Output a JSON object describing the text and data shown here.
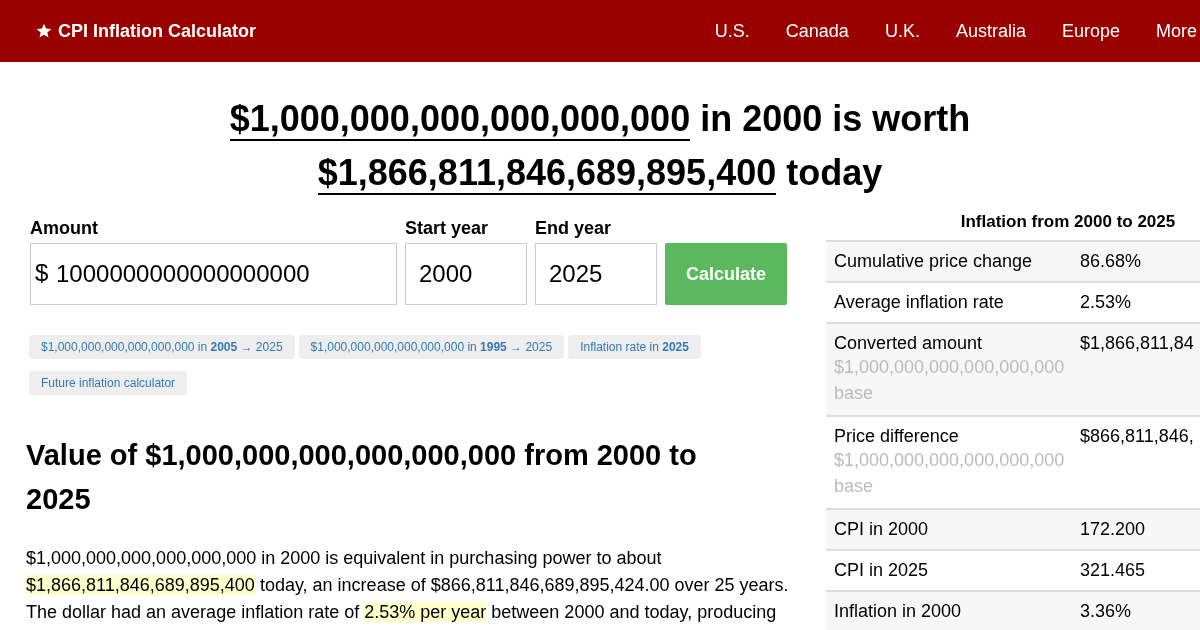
{
  "header": {
    "logo": "CPI Inflation Calculator",
    "nav": [
      "U.S.",
      "Canada",
      "U.K.",
      "Australia",
      "Europe",
      "More"
    ]
  },
  "headline": {
    "lines": [
      [
        {
          "text": "$1,000,000,000,000,000,000",
          "link": true
        },
        {
          "text": " in 2000 is worth",
          "link": false
        }
      ],
      [
        {
          "text": "$1,866,811,846,689,895,400",
          "link": true
        },
        {
          "text": " today",
          "link": false
        }
      ]
    ]
  },
  "form": {
    "fields": [
      {
        "label": "Amount",
        "prefix": "$",
        "value": "1000000000000000000"
      },
      {
        "label": "Start year",
        "value": "2000"
      },
      {
        "label": "End year",
        "value": "2025"
      }
    ],
    "button": "Calculate"
  },
  "chips": [
    "$1,000,000,000,000,000,000 in **2005** → 2025",
    "$1,000,000,000,000,000,000 in **1995** → 2025",
    "Inflation rate in **2025**",
    "Future inflation calculator"
  ],
  "section": {
    "heading": "Value of $1,000,000,000,000,000,000 from 2000 to 2025",
    "paragraph": [
      {
        "text": "$1,000,000,000,000,000,000 in 2000 is equivalent in purchasing power to about ",
        "highlighted": false
      },
      {
        "text": "$1,866,811,846,689,895,400",
        "highlighted": true
      },
      {
        "text": " today, an increase of $866,811,846,689,895,424.00 over 25 years. The dollar had an average inflation rate of ",
        "highlighted": false
      },
      {
        "text": "2.53% per year",
        "highlighted": true
      },
      {
        "text": " between 2000 and today, producing",
        "highlighted": false
      }
    ]
  },
  "table": {
    "title": "Inflation from 2000 to 2025",
    "rows": [
      {
        "label": "Cumulative price change",
        "value": "86.68%"
      },
      {
        "label": "Average inflation rate",
        "value": "2.53%"
      },
      {
        "label": "Converted amount",
        "note": "$1,000,000,000,000,000,000 base",
        "value": "$1,866,811,84"
      },
      {
        "label": "Price difference",
        "note": "$1,000,000,000,000,000,000 base",
        "value": "$866,811,846,"
      },
      {
        "label": "CPI in 2000",
        "value": "172.200"
      },
      {
        "label": "CPI in 2025",
        "value": "321.465"
      },
      {
        "label": "Inflation in 2000",
        "value": "3.36%"
      }
    ]
  }
}
